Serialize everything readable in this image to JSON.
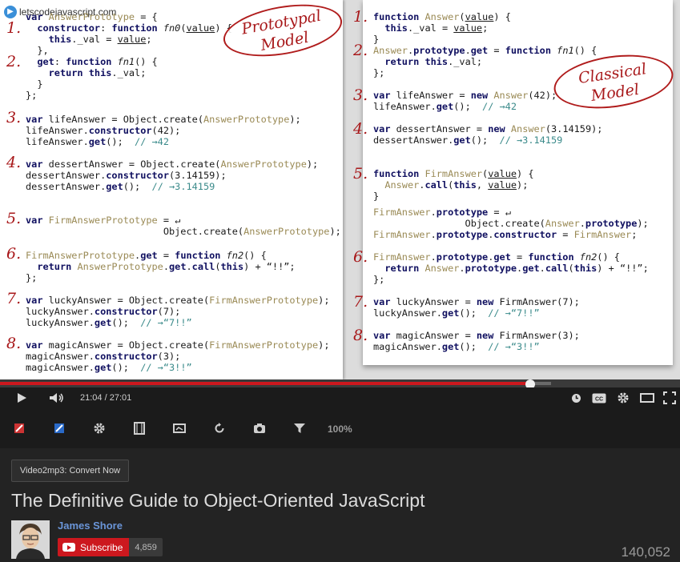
{
  "brand": {
    "text": "letscodejavascript.com",
    "logo_icon": "play-logo-icon"
  },
  "left_panel": {
    "stamp": [
      "Prototypal",
      "Model"
    ],
    "numbers": [
      "1.",
      "2.",
      "3.",
      "4.",
      "5.",
      "6.",
      "7.",
      "8."
    ]
  },
  "right_panel": {
    "stamp": [
      "Classical",
      "Model"
    ],
    "numbers": [
      "1.",
      "2.",
      "3.",
      "4.",
      "5.",
      "6.",
      "7.",
      "8."
    ]
  },
  "code_tokens": {
    "var": "var",
    "function": "function",
    "return": "return",
    "new": "new",
    "this": "this",
    "answerPrototype": "AnswerPrototype",
    "answer": "Answer",
    "prototype": "prototype",
    "firmAnswerPrototype": "FirmAnswerPrototype",
    "firmAnswer": "FirmAnswer",
    "objectCreate": "Object.create",
    "constructor": "constructor",
    "get": "get",
    "call": "call",
    "value": "value",
    "val": "_val",
    "fn0": "fn0",
    "fn1": "fn1",
    "fn2": "fn2",
    "lifeAnswer": "lifeAnswer",
    "dessertAnswer": "dessertAnswer",
    "luckyAnswer": "luckyAnswer",
    "magicAnswer": "magicAnswer",
    "n42": "42",
    "n314": "3.14159",
    "n7": "7",
    "n3": "3",
    "bang": "“!!”",
    "c42": "// →42",
    "c314": "// →3.14159",
    "c7": "// →“7!!”",
    "c3": "// →“3!!”",
    "continuation": "↵"
  },
  "player": {
    "current_time": "21:04",
    "duration": "27:01",
    "progress_fraction": 0.78,
    "buffered_fraction": 0.81,
    "accent_color": "#cc181e"
  },
  "toolbar": {
    "icons": [
      "colorpicker-icon",
      "colorpicker-alt-icon",
      "gear-icon",
      "film-icon",
      "screen-icon",
      "replay-icon",
      "camera-icon",
      "filter-icon"
    ],
    "zoom": "100%"
  },
  "video_info": {
    "convert_button": "Video2mp3: Convert Now",
    "title": "The Definitive Guide to Object-Oriented JavaScript",
    "channel": "James Shore",
    "subscribe_label": "Subscribe",
    "subscriber_count": "4,859",
    "views": "140,052"
  }
}
